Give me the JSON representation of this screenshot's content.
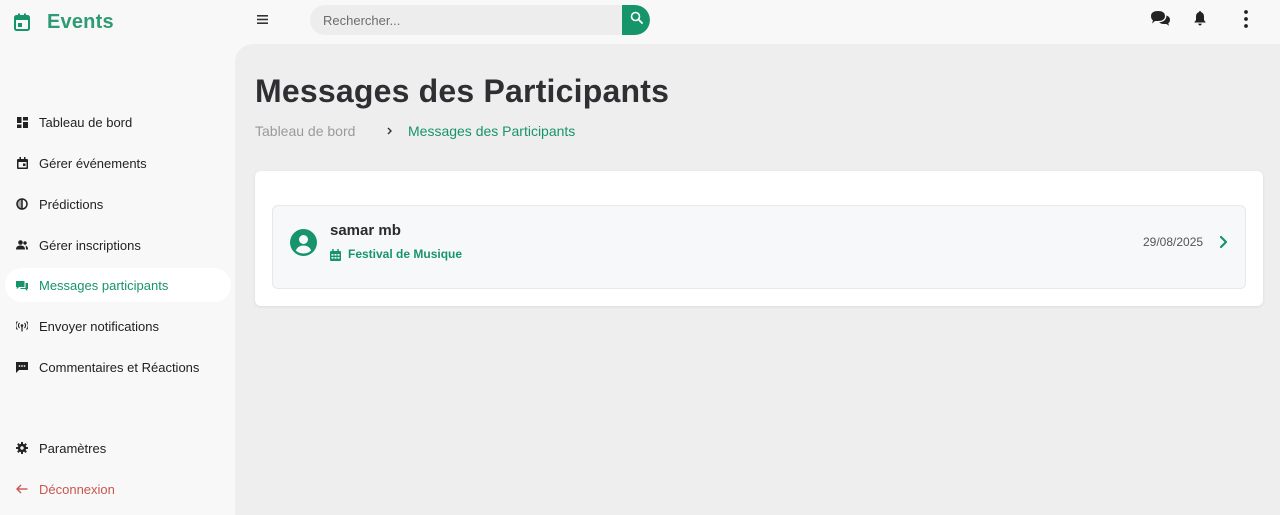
{
  "app": {
    "name": "Events"
  },
  "topbar": {
    "search_placeholder": "Rechercher..."
  },
  "sidebar": {
    "items": [
      {
        "label": "Tableau de bord",
        "icon": "dashboard-icon"
      },
      {
        "label": "Gérer événements",
        "icon": "calendar-event-icon"
      },
      {
        "label": "Prédictions",
        "icon": "prediction-icon"
      },
      {
        "label": "Gérer inscriptions",
        "icon": "users-icon"
      },
      {
        "label": "Messages participants",
        "icon": "messages-icon",
        "active": true
      },
      {
        "label": "Envoyer notifications",
        "icon": "broadcast-icon"
      },
      {
        "label": "Commentaires et Réactions",
        "icon": "comment-icon"
      }
    ],
    "settings_label": "Paramètres",
    "logout_label": "Déconnexion"
  },
  "page": {
    "title": "Messages des Participants",
    "breadcrumb": {
      "home": "Tableau de bord",
      "current": "Messages des Participants"
    }
  },
  "messages": [
    {
      "sender": "samar mb",
      "event": "Festival de Musique",
      "date": "29/08/2025"
    }
  ],
  "colors": {
    "brand": "#2e9b74",
    "accent": "#17956a",
    "logout": "#c9574f"
  }
}
